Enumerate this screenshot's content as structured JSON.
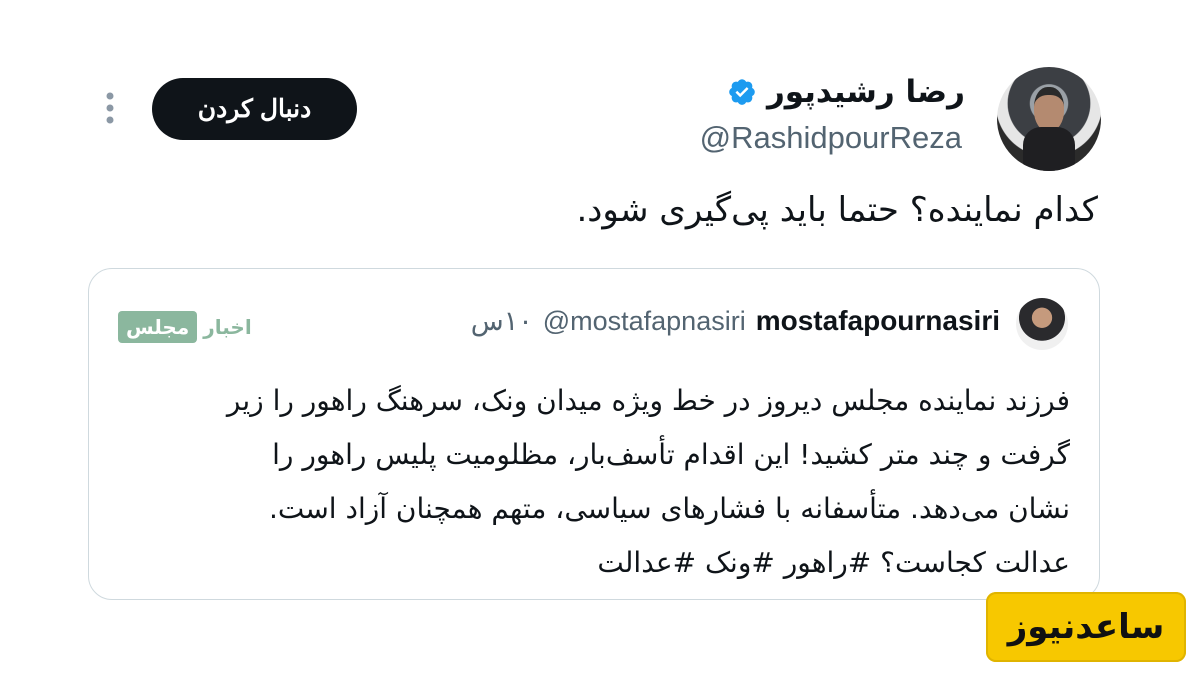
{
  "author": {
    "display_name": "رضا رشیدپور",
    "handle": "@RashidpourReza",
    "verified": true
  },
  "follow_button_label": "دنبال کردن",
  "tweet_text": "کدام نماینده؟ حتما باید پی‌گیری شود.",
  "quoted_tweet": {
    "name": "mostafapournasiri",
    "handle": "@mostafapnasiri",
    "time": "۱۰س",
    "lines": [
      "فرزند نماینده مجلس دیروز در خط ویژه میدان ونک، سرهنگ راهور را زیر",
      "گرفت و چند متر کشید! این اقدام تأسف‌بار، مظلومیت پلیس راهور را",
      "نشان می‌دهد. متأسفانه با فشارهای سیاسی، متهم همچنان آزاد است.",
      "عدالت کجاست؟ #راهور #ونک #عدالت"
    ]
  },
  "watermarks": {
    "akhbar_majlis_a": "مجلس",
    "akhbar_majlis_b": "اخبار",
    "saednews": "ساعدنیوز"
  },
  "colors": {
    "verified_blue": "#1d9bf0",
    "secondary_text": "#536471",
    "follow_button_bg": "#0f1419",
    "saednews_yellow": "#f7c800"
  }
}
